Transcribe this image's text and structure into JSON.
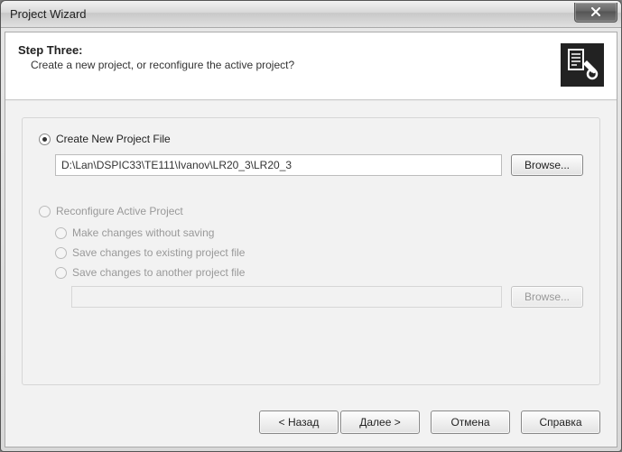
{
  "window": {
    "title": "Project Wizard"
  },
  "header": {
    "step_title": "Step Three:",
    "step_desc": "Create a new project, or reconfigure the active project?"
  },
  "options": {
    "create_label": "Create New Project File",
    "create_path": "D:\\Lan\\DSPIC33\\TE111\\Ivanov\\LR20_3\\LR20_3",
    "browse_label": "Browse...",
    "reconfigure_label": "Reconfigure Active Project",
    "sub1_label": "Make changes without saving",
    "sub2_label": "Save changes to existing project file",
    "sub3_label": "Save changes to another project file",
    "save_path": "",
    "browse2_label": "Browse..."
  },
  "footer": {
    "back": "< Назад",
    "next": "Далее >",
    "cancel": "Отмена",
    "help": "Справка"
  }
}
